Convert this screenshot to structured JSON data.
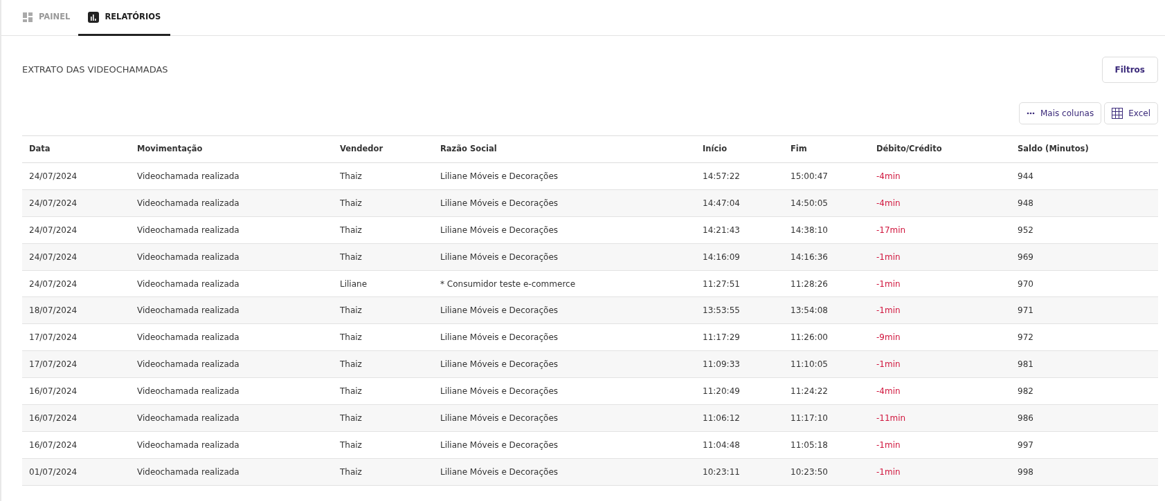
{
  "tabs": [
    {
      "label": "PAINEL",
      "kind": "grid",
      "selected": false
    },
    {
      "label": "RELATÓRIOS",
      "kind": "chart",
      "selected": true
    }
  ],
  "title": "EXTRATO DAS VIDEOCHAMADAS",
  "filter_button": "Filtros",
  "toolbar": [
    {
      "label": "Mais colunas",
      "kind": "dots"
    },
    {
      "label": "Excel",
      "kind": "grid"
    }
  ],
  "table": {
    "columns": [
      {
        "label": "Data",
        "kind": "text"
      },
      {
        "label": "Movimentação",
        "kind": "text"
      },
      {
        "label": "Vendedor",
        "kind": "text"
      },
      {
        "label": "Razão Social",
        "kind": "text"
      },
      {
        "label": "Início",
        "kind": "text"
      },
      {
        "label": "Fim",
        "kind": "text"
      },
      {
        "label": "Débito/Crédito",
        "kind": "debit"
      },
      {
        "label": "Saldo (Minutos)",
        "kind": "text"
      }
    ],
    "rows": [
      [
        "24/07/2024",
        "Videochamada realizada",
        "Thaiz",
        "Liliane Móveis e Decorações",
        "14:57:22",
        "15:00:47",
        "-4min",
        "944"
      ],
      [
        "24/07/2024",
        "Videochamada realizada",
        "Thaiz",
        "Liliane Móveis e Decorações",
        "14:47:04",
        "14:50:05",
        "-4min",
        "948"
      ],
      [
        "24/07/2024",
        "Videochamada realizada",
        "Thaiz",
        "Liliane Móveis e Decorações",
        "14:21:43",
        "14:38:10",
        "-17min",
        "952"
      ],
      [
        "24/07/2024",
        "Videochamada realizada",
        "Thaiz",
        "Liliane Móveis e Decorações",
        "14:16:09",
        "14:16:36",
        "-1min",
        "969"
      ],
      [
        "24/07/2024",
        "Videochamada realizada",
        "Liliane",
        "* Consumidor teste e-commerce",
        "11:27:51",
        "11:28:26",
        "-1min",
        "970"
      ],
      [
        "18/07/2024",
        "Videochamada realizada",
        "Thaiz",
        "Liliane Móveis e Decorações",
        "13:53:55",
        "13:54:08",
        "-1min",
        "971"
      ],
      [
        "17/07/2024",
        "Videochamada realizada",
        "Thaiz",
        "Liliane Móveis e Decorações",
        "11:17:29",
        "11:26:00",
        "-9min",
        "972"
      ],
      [
        "17/07/2024",
        "Videochamada realizada",
        "Thaiz",
        "Liliane Móveis e Decorações",
        "11:09:33",
        "11:10:05",
        "-1min",
        "981"
      ],
      [
        "16/07/2024",
        "Videochamada realizada",
        "Thaiz",
        "Liliane Móveis e Decorações",
        "11:20:49",
        "11:24:22",
        "-4min",
        "982"
      ],
      [
        "16/07/2024",
        "Videochamada realizada",
        "Thaiz",
        "Liliane Móveis e Decorações",
        "11:06:12",
        "11:17:10",
        "-11min",
        "986"
      ],
      [
        "16/07/2024",
        "Videochamada realizada",
        "Thaiz",
        "Liliane Móveis e Decorações",
        "11:04:48",
        "11:05:18",
        "-1min",
        "997"
      ],
      [
        "01/07/2024",
        "Videochamada realizada",
        "Thaiz",
        "Liliane Móveis e Decorações",
        "10:23:11",
        "10:23:50",
        "-1min",
        "998"
      ]
    ]
  }
}
